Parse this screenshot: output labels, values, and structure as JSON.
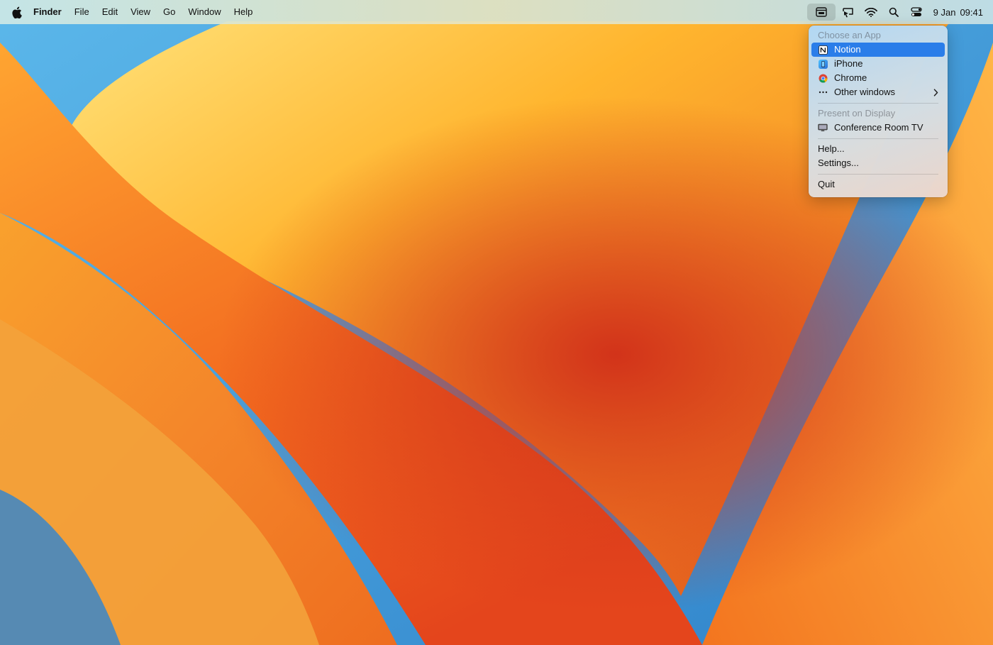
{
  "menubar": {
    "app_name": "Finder",
    "menus": [
      "File",
      "Edit",
      "View",
      "Go",
      "Window",
      "Help"
    ],
    "status_icons": [
      "screen-sharing-icon",
      "screen-mirror-icon",
      "wifi-icon",
      "search-icon",
      "control-center-icon"
    ],
    "date": "9 Jan",
    "time": "09:41"
  },
  "dropdown": {
    "choose_title": "Choose an App",
    "apps": [
      {
        "label": "Notion",
        "icon": "notion-icon",
        "selected": true
      },
      {
        "label": "iPhone",
        "icon": "iphone-mirroring-icon"
      },
      {
        "label": "Chrome",
        "icon": "chrome-icon"
      },
      {
        "label": "Other windows",
        "icon": "ellipsis-icon"
      }
    ],
    "present_title": "Present on Display",
    "display_label": "Conference Room TV",
    "help_label": "Help...",
    "settings_label": "Settings...",
    "quit_label": "Quit"
  },
  "colors": {
    "selection": "#2a7de9"
  }
}
